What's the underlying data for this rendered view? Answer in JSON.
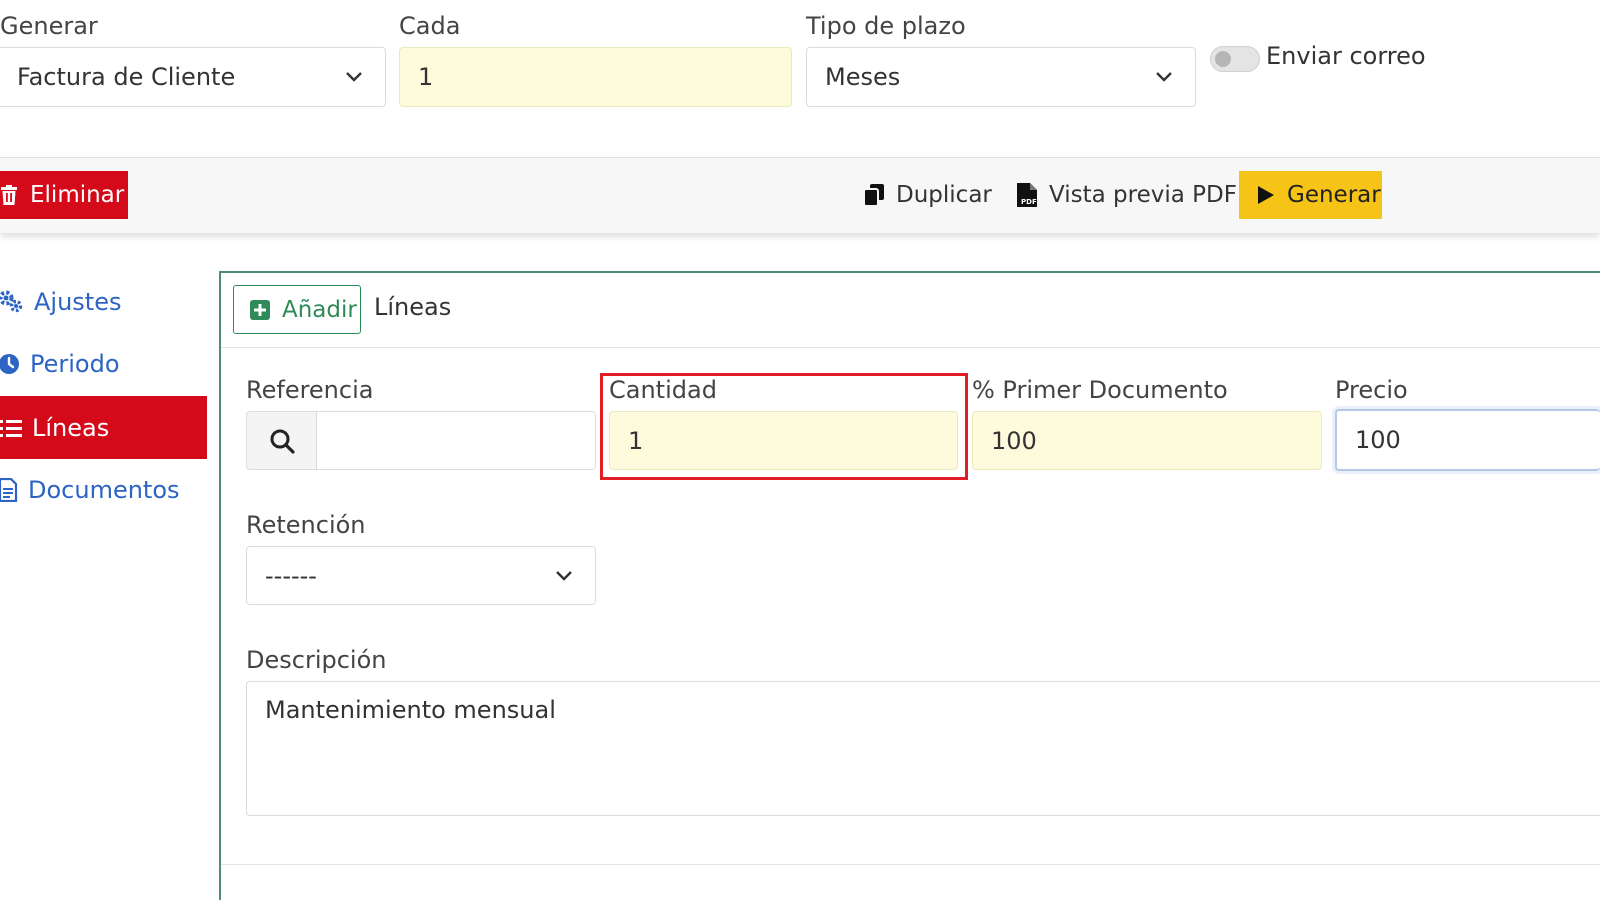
{
  "top_form": {
    "generar": {
      "label": "Generar",
      "value": "Factura de Cliente"
    },
    "cada": {
      "label": "Cada",
      "value": "1"
    },
    "tipo_plazo": {
      "label": "Tipo de plazo",
      "value": "Meses"
    },
    "enviar_correo": {
      "label": "Enviar correo",
      "checked": false
    }
  },
  "toolbar": {
    "delete_label": "Eliminar",
    "duplicate_label": "Duplicar",
    "pdf_label": "Vista previa PDF",
    "generate_label": "Generar"
  },
  "sidebar": {
    "items": [
      {
        "label": "Ajustes",
        "icon": "gears-icon",
        "active": false
      },
      {
        "label": "Periodo",
        "icon": "clock-icon",
        "active": false
      },
      {
        "label": "Líneas",
        "icon": "list-icon",
        "active": true
      },
      {
        "label": "Documentos",
        "icon": "document-icon",
        "active": false
      }
    ]
  },
  "lines_panel": {
    "add_label": "Añadir",
    "title": "Líneas",
    "referencia": {
      "label": "Referencia",
      "value": ""
    },
    "cantidad": {
      "label": "Cantidad",
      "value": "1"
    },
    "primer_documento": {
      "label": "% Primer Documento",
      "value": "100"
    },
    "precio": {
      "label": "Precio",
      "value": "100"
    },
    "retencion": {
      "label": "Retención",
      "value": "------"
    },
    "descripcion": {
      "label": "Descripción",
      "value": "Mantenimiento mensual"
    }
  },
  "colors": {
    "danger": "#d40a1a",
    "warning": "#f5c416",
    "success": "#2e8b57",
    "link": "#2d64c4",
    "highlight_border": "#e01c24",
    "input_yellow": "#fdfbdc"
  }
}
